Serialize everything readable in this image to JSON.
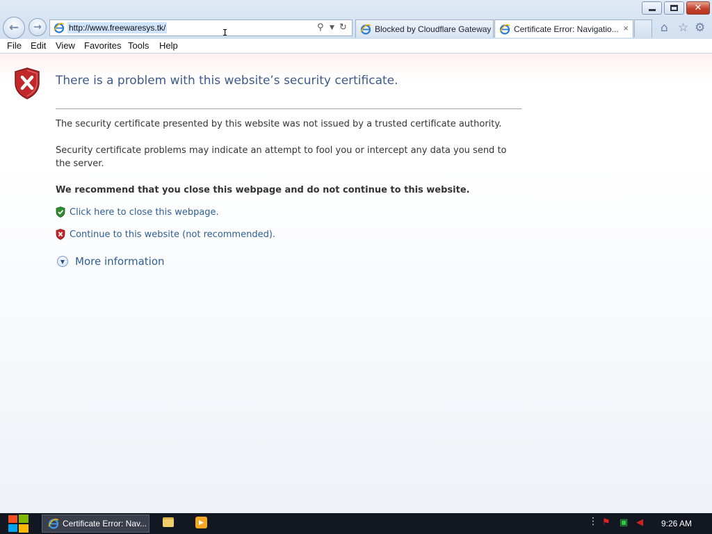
{
  "browser": {
    "address_bar": {
      "url": "http://www.freewaresys.tk/"
    },
    "tabs": [
      {
        "label": "Blocked by Cloudflare Gateway",
        "active": false
      },
      {
        "label": "Certificate Error: Navigatio...",
        "active": true,
        "close_icon": "×"
      }
    ],
    "toolbar_icons": [
      "home-icon",
      "favorites-star-icon",
      "tools-gear-icon"
    ],
    "nav_icons": [
      "back-arrow-icon",
      "forward-arrow-icon"
    ],
    "address_icons": [
      "search-icon",
      "dropdown-icon",
      "refresh-icon"
    ]
  },
  "menu": {
    "items": [
      "File",
      "Edit",
      "View",
      "Favorites",
      "Tools",
      "Help"
    ]
  },
  "page": {
    "title": "There is a problem with this website’s security certificate.",
    "paragraph_1": "The security certificate presented by this website was not issued by a trusted certificate authority.",
    "paragraph_2": "Security certificate problems may indicate an attempt to fool you or intercept any data you send to the server.",
    "recommendation": "We recommend that you close this webpage and do not continue to this website.",
    "close_link": "Click here to close this webpage.",
    "continue_link": "Continue to this website (not recommended).",
    "more_info": "More information"
  },
  "taskbar": {
    "task_label": "Certificate Error: Nav...",
    "clock": "9:26 AM"
  },
  "colors": {
    "title_blue": "#3c5a8a",
    "link_blue": "#2d5f94",
    "error_red": "#c0282a",
    "ok_green": "#2e8b2e",
    "taskbar": "#131722"
  }
}
